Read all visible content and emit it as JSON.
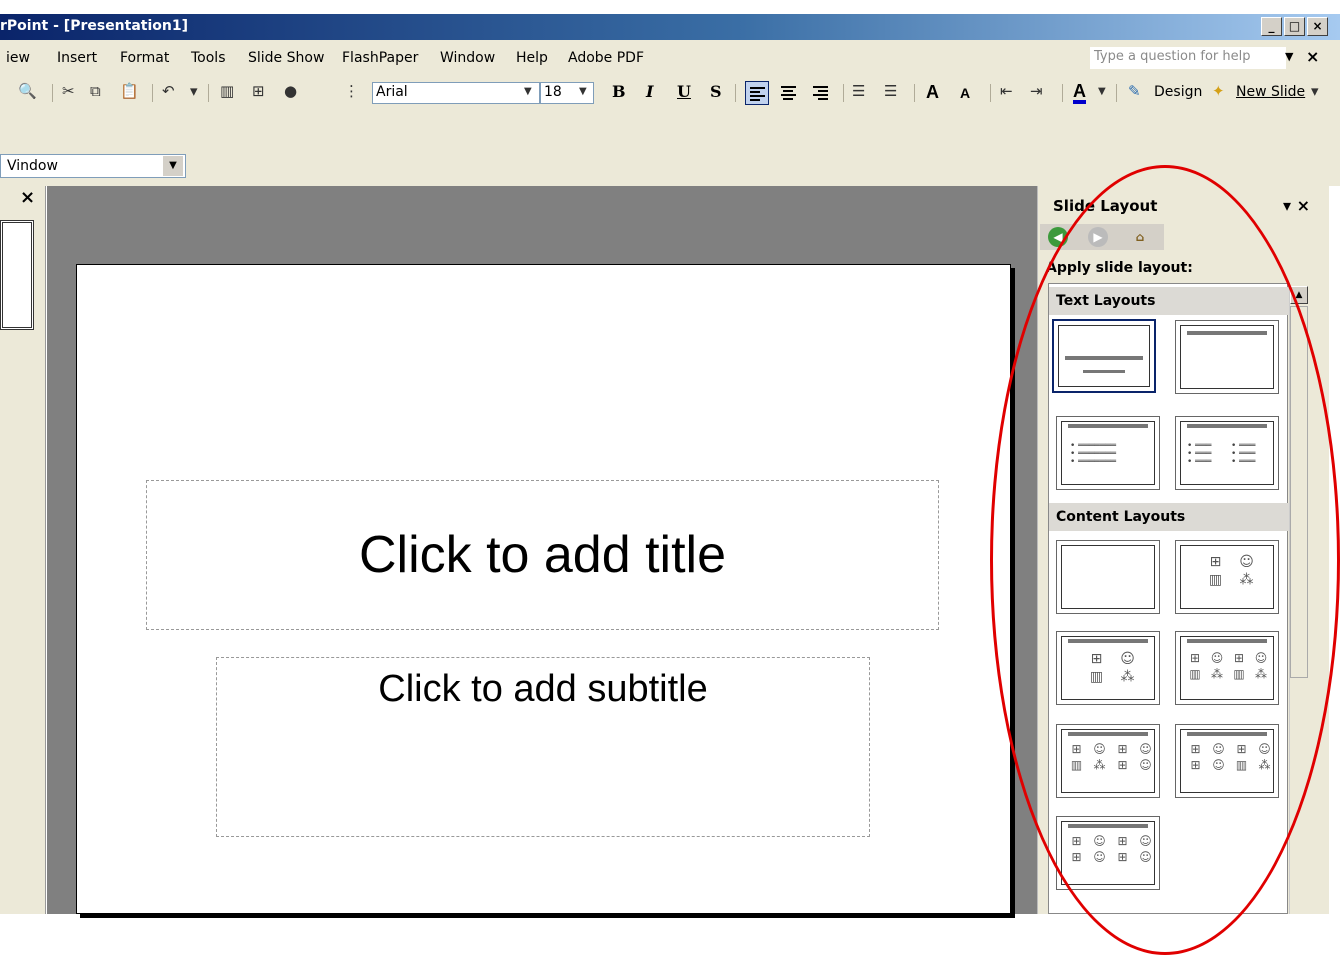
{
  "window": {
    "title": "rPoint - [Presentation1]",
    "controls": [
      "_",
      "□",
      "×"
    ]
  },
  "menu": {
    "items": [
      "iew",
      "Insert",
      "Format",
      "Tools",
      "Slide Show",
      "FlashPaper",
      "Window",
      "Help",
      "Adobe PDF"
    ],
    "help_placeholder": "Type a question for help"
  },
  "toolbar": {
    "font": "Arial",
    "size": "18",
    "bold": "B",
    "italic": "I",
    "underline": "U",
    "shadow": "S",
    "grow_font": "A",
    "shrink_font": "A",
    "font_color": "A",
    "design_label": "Design",
    "new_slide_label": "New Slide"
  },
  "window_selector": {
    "value": "Vindow"
  },
  "slides_pane": {
    "close": "×"
  },
  "slide": {
    "title_placeholder": "Click to add title",
    "subtitle_placeholder": "Click to add subtitle"
  },
  "task_pane": {
    "title": "Slide Layout",
    "apply_label": "Apply slide layout:",
    "sections": [
      {
        "label": "Text Layouts"
      },
      {
        "label": "Content Layouts"
      }
    ]
  },
  "colors": {
    "titlebar_start": "#0a246a",
    "titlebar_end": "#a6caf0",
    "chrome": "#ece9d8",
    "workarea": "#808080",
    "annotation": "#e00000"
  }
}
